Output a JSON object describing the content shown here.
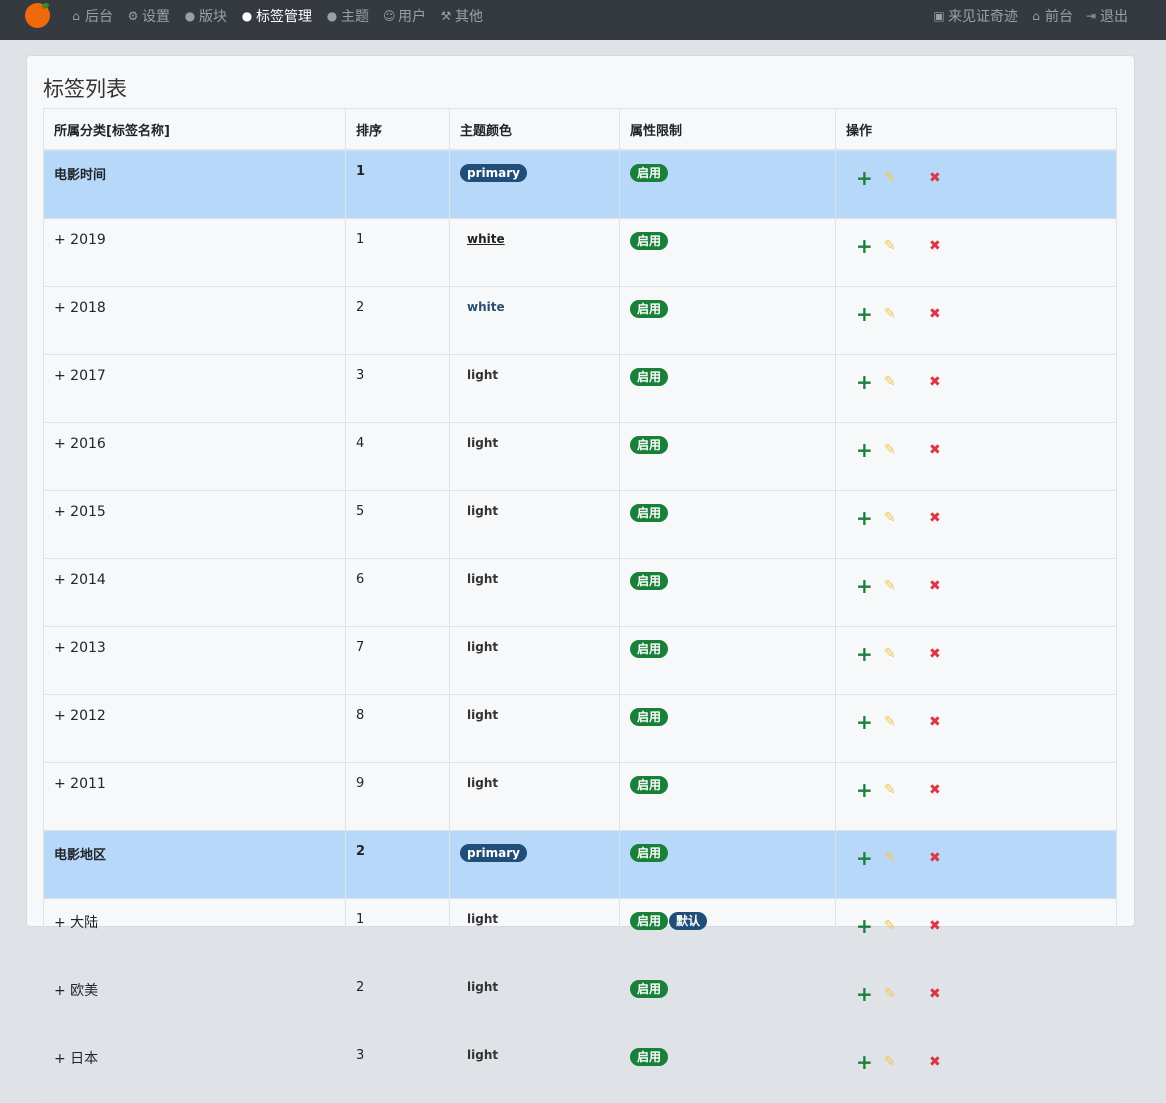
{
  "nav": {
    "left": [
      {
        "icon": "home-icon",
        "glyph": "⌂",
        "label": "后台",
        "active": false
      },
      {
        "icon": "gear-icon",
        "glyph": "⚙",
        "label": "设置",
        "active": false
      },
      {
        "icon": "comment-icon",
        "glyph": "●",
        "label": "版块",
        "active": false
      },
      {
        "icon": "comment-icon",
        "glyph": "●",
        "label": "标签管理",
        "active": true
      },
      {
        "icon": "comment-icon",
        "glyph": "●",
        "label": "主题",
        "active": false
      },
      {
        "icon": "user-icon",
        "glyph": "☺",
        "label": "用户",
        "active": false
      },
      {
        "icon": "wrench-icon",
        "glyph": "⚒",
        "label": "其他",
        "active": false
      }
    ],
    "right": [
      {
        "icon": "avatar-icon",
        "glyph": "▣",
        "label": "来见证奇迹"
      },
      {
        "icon": "home-icon",
        "glyph": "⌂",
        "label": "前台"
      },
      {
        "icon": "logout-icon",
        "glyph": "⇥",
        "label": "退出"
      }
    ]
  },
  "page": {
    "title": "标签列表"
  },
  "table": {
    "headers": [
      "所属分类[标签名称]",
      "排序",
      "主题颜色",
      "属性限制",
      "操作"
    ],
    "rows": [
      {
        "type": "parent",
        "name": "电影时间",
        "order": "1",
        "color": "primary",
        "color_style": "badge",
        "limits": [
          "启用"
        ]
      },
      {
        "type": "child",
        "name": "+ 2019",
        "order": "1",
        "color": "white",
        "color_style": "link",
        "limits": [
          "启用"
        ]
      },
      {
        "type": "child",
        "name": "+ 2018",
        "order": "2",
        "color": "white",
        "color_style": "w2",
        "limits": [
          "启用"
        ]
      },
      {
        "type": "child",
        "name": "+ 2017",
        "order": "3",
        "color": "light",
        "color_style": "text",
        "limits": [
          "启用"
        ]
      },
      {
        "type": "child",
        "name": "+ 2016",
        "order": "4",
        "color": "light",
        "color_style": "text",
        "limits": [
          "启用"
        ]
      },
      {
        "type": "child",
        "name": "+ 2015",
        "order": "5",
        "color": "light",
        "color_style": "text",
        "limits": [
          "启用"
        ]
      },
      {
        "type": "child",
        "name": "+ 2014",
        "order": "6",
        "color": "light",
        "color_style": "text",
        "limits": [
          "启用"
        ]
      },
      {
        "type": "child",
        "name": "+ 2013",
        "order": "7",
        "color": "light",
        "color_style": "text",
        "limits": [
          "启用"
        ]
      },
      {
        "type": "child",
        "name": "+ 2012",
        "order": "8",
        "color": "light",
        "color_style": "text",
        "limits": [
          "启用"
        ]
      },
      {
        "type": "child",
        "name": "+ 2011",
        "order": "9",
        "color": "light",
        "color_style": "text",
        "limits": [
          "启用"
        ]
      },
      {
        "type": "parent",
        "name": "电影地区",
        "order": "2",
        "color": "primary",
        "color_style": "badge",
        "limits": [
          "启用"
        ]
      },
      {
        "type": "child",
        "name": "+ 大陆",
        "order": "1",
        "color": "light",
        "color_style": "text",
        "limits": [
          "启用",
          "默认"
        ]
      },
      {
        "type": "child",
        "name": "+ 欧美",
        "order": "2",
        "color": "light",
        "color_style": "text",
        "limits": [
          "启用"
        ]
      },
      {
        "type": "child",
        "name": "+ 日本",
        "order": "3",
        "color": "light",
        "color_style": "text",
        "limits": [
          "启用"
        ]
      }
    ],
    "ops": {
      "add": "+",
      "edit": "✎",
      "delete": "✖"
    }
  },
  "colors": {
    "navbar": "#343a40",
    "parent_row": "#b8d8fa",
    "success": "#198039",
    "primary": "#1f4e79",
    "add": "#198039",
    "edit": "#f2c94c",
    "delete": "#dc3545"
  }
}
